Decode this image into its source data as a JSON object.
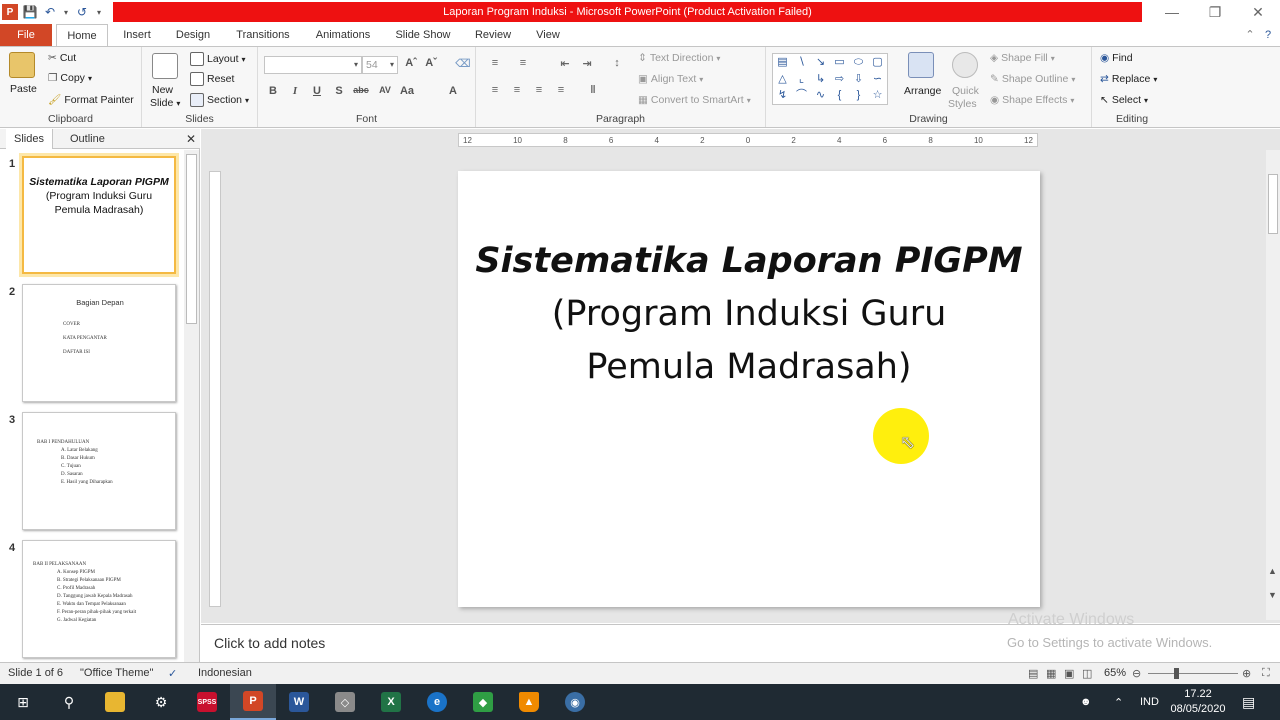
{
  "window": {
    "title": "Laporan Program Induksi  -  Microsoft PowerPoint (Product Activation Failed)"
  },
  "tabs": [
    "File",
    "Home",
    "Insert",
    "Design",
    "Transitions",
    "Animations",
    "Slide Show",
    "Review",
    "View"
  ],
  "ribbon": {
    "clipboard": {
      "paste": "Paste",
      "cut": "Cut",
      "copy": "Copy",
      "format_painter": "Format Painter",
      "label": "Clipboard"
    },
    "slides": {
      "new_slide_1": "New",
      "new_slide_2": "Slide",
      "layout": "Layout",
      "reset": "Reset",
      "section": "Section",
      "label": "Slides"
    },
    "font": {
      "size": "54",
      "label": "Font"
    },
    "paragraph": {
      "text_direction": "Text Direction",
      "align_text": "Align Text",
      "convert": "Convert to SmartArt",
      "label": "Paragraph"
    },
    "drawing": {
      "arrange": "Arrange",
      "quick_styles_1": "Quick",
      "quick_styles_2": "Styles",
      "shape_fill": "Shape Fill",
      "shape_outline": "Shape Outline",
      "shape_effects": "Shape Effects",
      "label": "Drawing"
    },
    "editing": {
      "find": "Find",
      "replace": "Replace",
      "select": "Select",
      "label": "Editing"
    }
  },
  "panel": {
    "slides_tab": "Slides",
    "outline_tab": "Outline"
  },
  "thumbnails": [
    {
      "num": "1",
      "line1": "Sistematika Laporan  PIGPM",
      "line2": "(Program Induksi Guru",
      "line3": "Pemula Madrasah)"
    },
    {
      "num": "2",
      "heading": "Bagian Depan",
      "items": [
        "COVER",
        "KATA PENGANTAR",
        "DAFTAR ISI"
      ]
    },
    {
      "num": "3",
      "heading": "BAB   I      PENDAHULUAN",
      "items": [
        "A. Latar Belakang",
        "B. Dasar Hukum",
        "C. Tujuan",
        "D. Sasaran",
        "E. Hasil yang Diharapkan"
      ]
    },
    {
      "num": "4",
      "heading": "BAB  II     PELAKSANAAN",
      "items": [
        "A. Konsep PIGPM",
        "B. Strategi Pelaksanaan PIGPM",
        "C. Profil Madrasah",
        "D. Tanggung jawab Kepala Madrasah",
        "E. Waktu dan Tempat Pelaksanaan",
        "F. Peran-peran pihak-pihak yang terkait",
        "G. Jadwal Kegiatan"
      ]
    }
  ],
  "ruler": {
    "labels": [
      "12",
      "10",
      "8",
      "6",
      "4",
      "2",
      "0",
      "2",
      "4",
      "6",
      "8",
      "10",
      "12"
    ]
  },
  "slide": {
    "title_bold": "Sistematika Laporan PIGPM",
    "line2": "(Program Induksi Guru",
    "line3": "Pemula Madrasah)"
  },
  "notes": {
    "placeholder": "Click to add notes"
  },
  "watermark": {
    "line1": "Activate Windows",
    "line2": "Go to Settings to activate Windows."
  },
  "status": {
    "slide_info": "Slide 1 of 6",
    "theme": "\"Office Theme\"",
    "language": "Indonesian",
    "zoom": "65%"
  },
  "taskbar": {
    "lang": "IND",
    "time": "17.22",
    "date": "08/05/2020"
  },
  "colors": {
    "file_tab": "#d24726",
    "title_strip": "#ee1111",
    "taskbar": "#1f2a33",
    "cursor_highlight": "#ffee00"
  }
}
